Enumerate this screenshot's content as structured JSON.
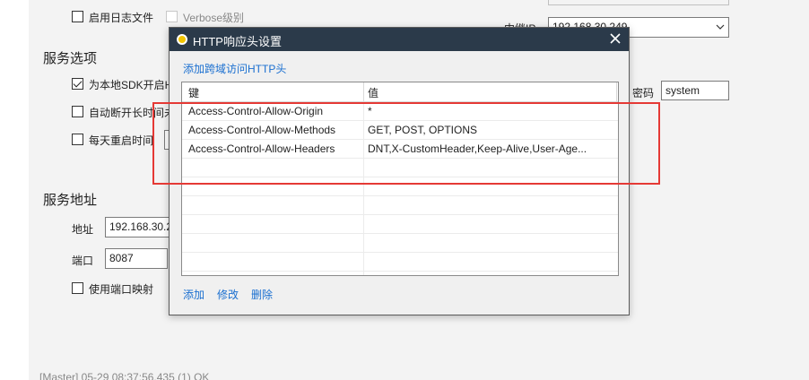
{
  "background": {
    "enable_log_file": "启用日志文件",
    "verbose_level": "Verbose级别",
    "relay_ip_label": "中继IP",
    "relay_ip_value": "192.168.30.249",
    "service_options_title": "服务选项",
    "sdk_option": "为本地SDK开启H",
    "auto_disconnect": "自动断开长时间未",
    "daily_restart": "每天重启时间",
    "password_label": "密码",
    "password_value": "system",
    "service_address_title": "服务地址",
    "address_label": "地址",
    "address_value": "192.168.30.2",
    "port_label": "端口",
    "port_value": "8087",
    "port_mapping": "使用端口映射",
    "status_line": "[Master] 05-29 08:37:56.435 (1) OK"
  },
  "dialog": {
    "title": "HTTP响应头设置",
    "add_cors_link": "添加跨域访问HTTP头",
    "columns": {
      "key": "键",
      "value": "值"
    },
    "rows": [
      {
        "key": "Access-Control-Allow-Origin",
        "value": "*"
      },
      {
        "key": "Access-Control-Allow-Methods",
        "value": "GET, POST, OPTIONS"
      },
      {
        "key": "Access-Control-Allow-Headers",
        "value": "DNT,X-CustomHeader,Keep-Alive,User-Age..."
      }
    ],
    "actions": {
      "add": "添加",
      "edit": "修改",
      "delete": "删除"
    }
  },
  "colors": {
    "titlebar": "#2b3a4a",
    "link": "#1a6fd0",
    "highlight": "#e53935"
  }
}
